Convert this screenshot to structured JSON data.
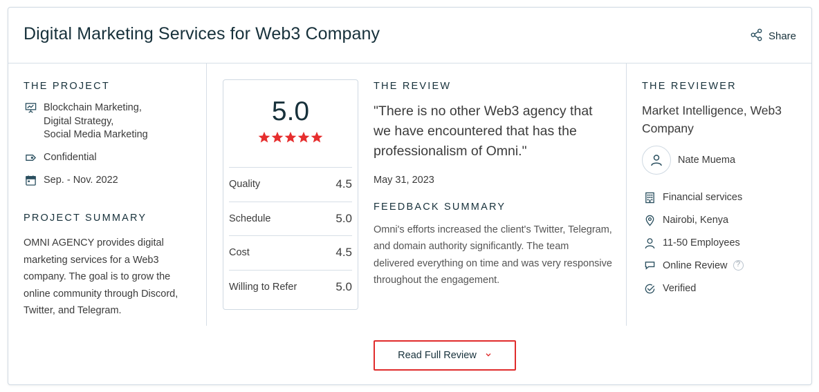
{
  "title": "Digital Marketing Services for Web3 Company",
  "share_label": "Share",
  "project": {
    "heading": "THE PROJECT",
    "services": [
      "Blockchain Marketing,",
      "Digital Strategy,",
      "Social Media Marketing"
    ],
    "budget": "Confidential",
    "dates": "Sep. - Nov. 2022",
    "summary_heading": "PROJECT SUMMARY",
    "summary": "OMNI AGENCY provides digital marketing services for a Web3 company. The goal is to grow the online community through Discord, Twitter, and Telegram."
  },
  "scores": {
    "overall": "5.0",
    "star_count": 5,
    "star_color": "#e62e2e",
    "rows": [
      {
        "label": "Quality",
        "value": "4.5"
      },
      {
        "label": "Schedule",
        "value": "5.0"
      },
      {
        "label": "Cost",
        "value": "4.5"
      },
      {
        "label": "Willing to Refer",
        "value": "5.0"
      }
    ]
  },
  "review": {
    "heading": "THE REVIEW",
    "quote": "\"There is no other Web3 agency that we have encountered that has the professionalism of Omni.\"",
    "date": "May 31, 2023",
    "feedback_heading": "FEEDBACK SUMMARY",
    "feedback": "Omni's efforts increased the client's Twitter, Telegram, and domain authority significantly. The team delivered everything on time and was very responsive throughout the engagement."
  },
  "reviewer": {
    "heading": "THE REVIEWER",
    "company": "Market Intelligence, Web3 Company",
    "name": "Nate Muema",
    "industry": "Financial services",
    "location": "Nairobi, Kenya",
    "size": "11-50 Employees",
    "review_type": "Online Review",
    "help_glyph": "?",
    "verified": "Verified"
  },
  "read_full_review": "Read Full Review",
  "colors": {
    "accent_red": "#e02b2b",
    "heading_dark": "#17313b",
    "border": "#cfd9e2"
  }
}
